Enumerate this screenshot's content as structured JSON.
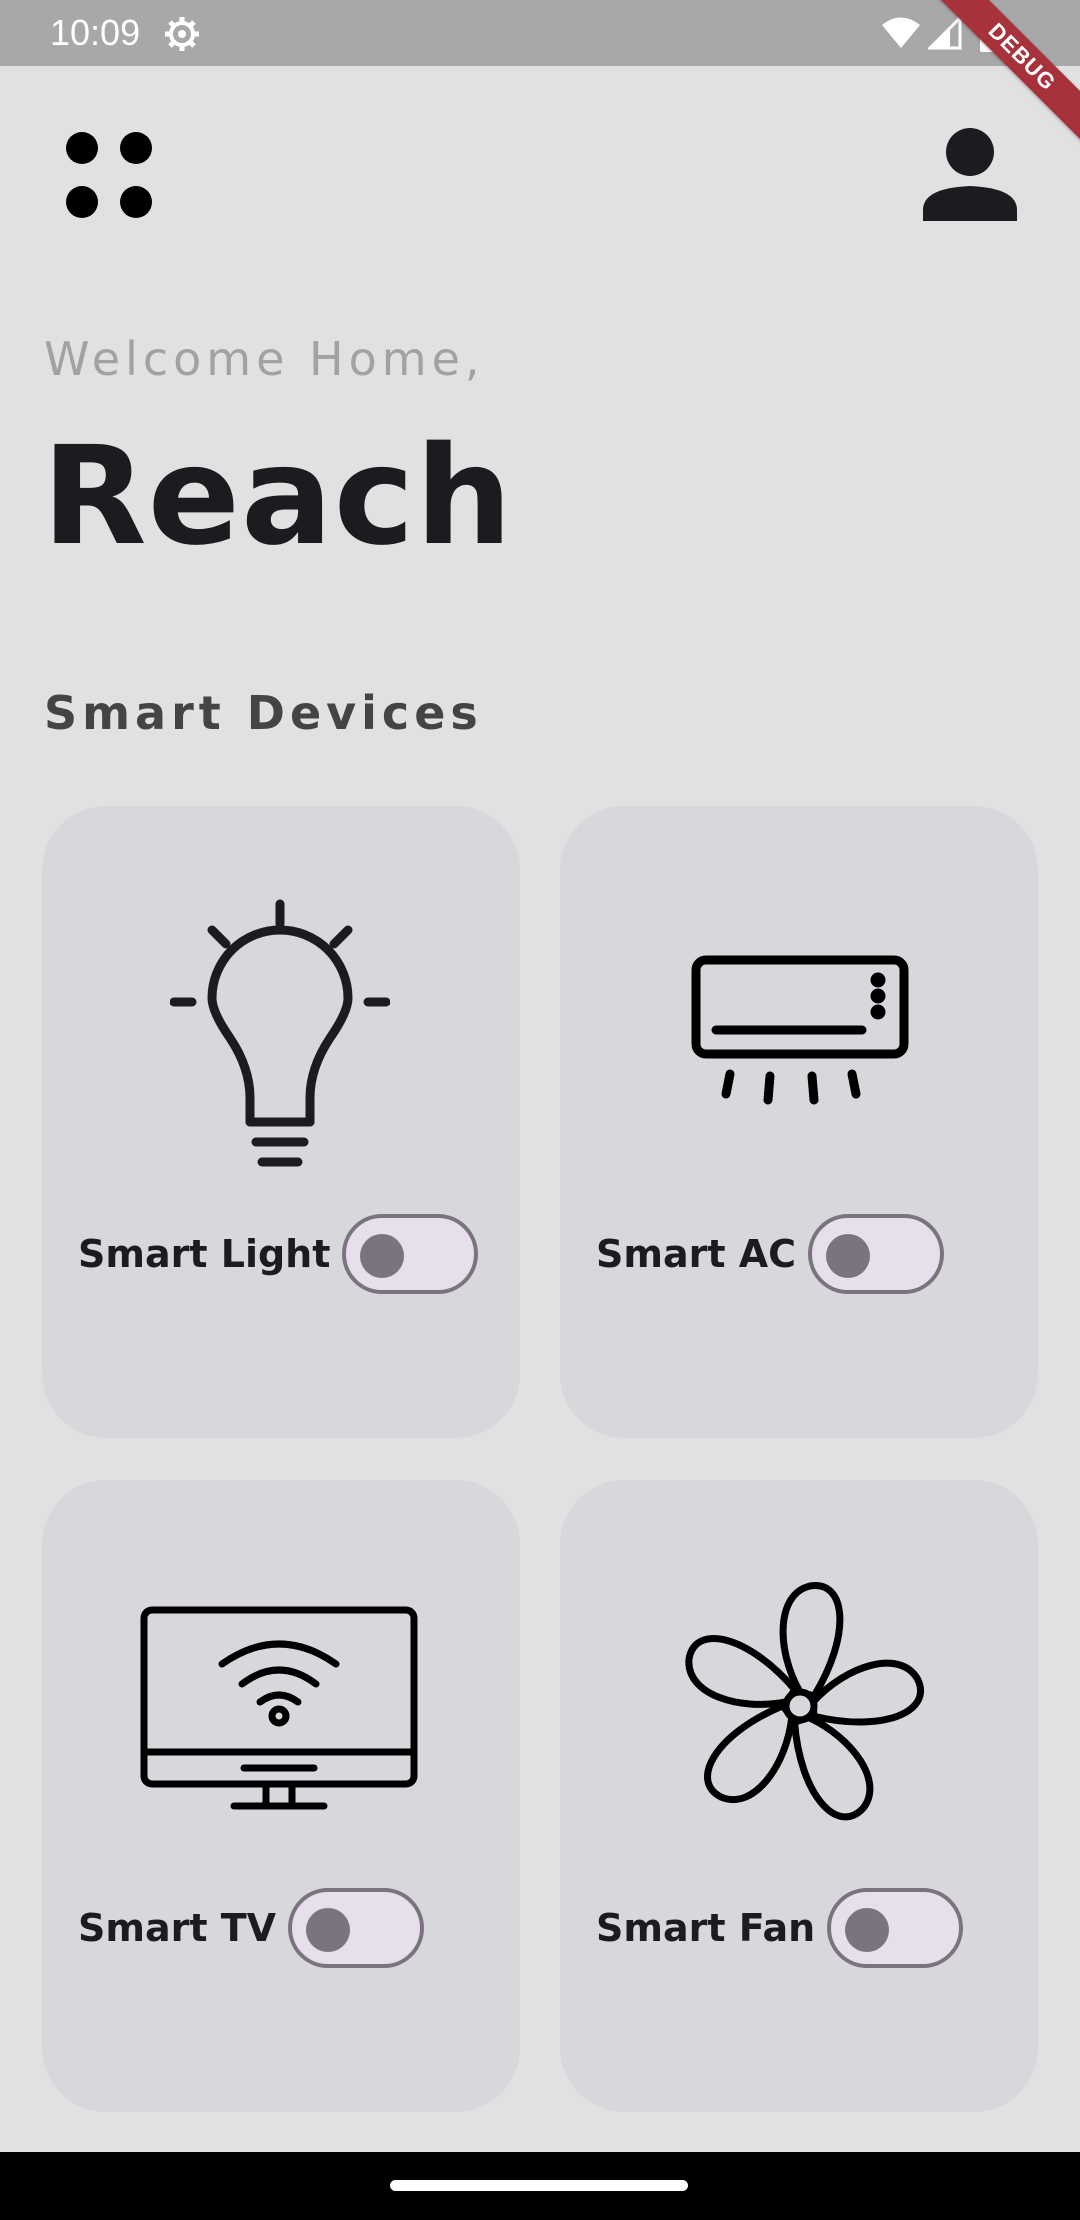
{
  "status_bar": {
    "time": "10:09",
    "icons": [
      "gear-icon",
      "wifi-icon",
      "signal-icon",
      "battery-icon"
    ]
  },
  "debug_banner": {
    "label": "DEBUG"
  },
  "header": {
    "menu_icon": "grid-dots-icon",
    "profile_icon": "person-icon"
  },
  "greeting": {
    "welcome": "Welcome Home,",
    "name": "Reach"
  },
  "section": {
    "title": "Smart Devices"
  },
  "devices": [
    {
      "label": "Smart Light",
      "icon": "light-bulb-icon",
      "on": false
    },
    {
      "label": "Smart AC",
      "icon": "air-conditioner-icon",
      "on": false
    },
    {
      "label": "Smart TV",
      "icon": "smart-tv-icon",
      "on": false
    },
    {
      "label": "Smart Fan",
      "icon": "fan-icon",
      "on": false
    }
  ],
  "colors": {
    "background": "#e1e1e1",
    "card": "#d8d7dc",
    "toggle_track": "#e7e0ec",
    "toggle_outline": "#79747e",
    "status_bar": "#a8a8a8",
    "debug_ribbon": "#a8323b"
  }
}
